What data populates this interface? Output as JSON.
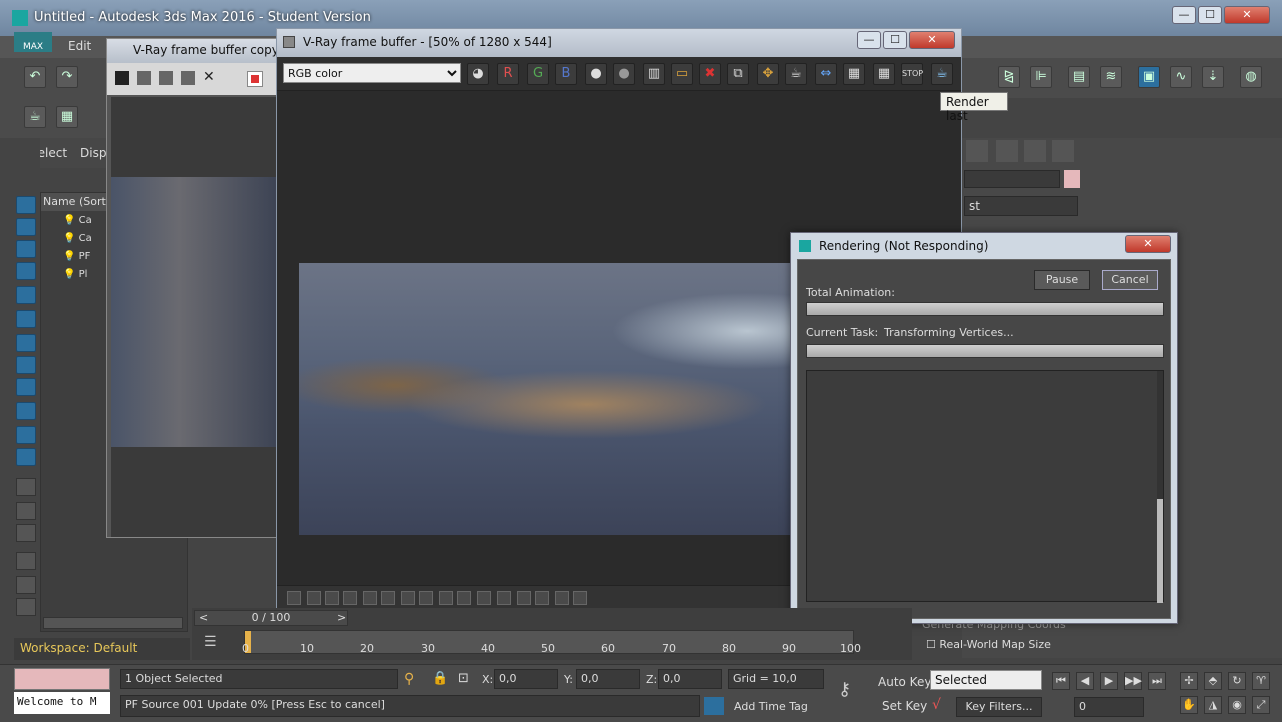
{
  "app": {
    "title": "Untitled - Autodesk 3ds Max 2016 - Student Version",
    "max_button": "MAX",
    "menu": [
      "Edit"
    ],
    "win_controls": {
      "min": "—",
      "max": "☐",
      "close": "✕"
    }
  },
  "command_panel": {
    "select_tab": "Select",
    "display_tab": "Disp",
    "list_value": "st",
    "real_world_map": "Real-World Map Size",
    "generate_mapping": "Generate Mapping Coords"
  },
  "scene_explorer": {
    "header": "Name (Sorte",
    "rows": [
      "Ca",
      "Ca",
      "PF",
      "Pl"
    ]
  },
  "vfb_copy": {
    "title": "V-Ray frame buffer copy, D"
  },
  "vfb": {
    "title": "V-Ray frame buffer - [50% of 1280 x 544]",
    "channel": "RGB color",
    "channel_buttons": {
      "r": "R",
      "g": "G",
      "b": "B"
    },
    "tooltip": "Render last"
  },
  "render_dialog": {
    "title": "Rendering (Not Responding)",
    "pause": "Pause",
    "cancel": "Cancel",
    "total_label": "Total Animation:",
    "task_label": "Current Task:",
    "task_value": "Transforming Vertices..."
  },
  "timeline": {
    "frame_counter": "0 / 100",
    "ticks": [
      "0",
      "10",
      "20",
      "30",
      "40",
      "50",
      "60",
      "70",
      "80",
      "90",
      "100"
    ],
    "prev": "<",
    "next": ">"
  },
  "workspace": "Workspace: Default",
  "status": {
    "selection": "1 Object Selected",
    "prompt": "PF Source 001 Update 0% [Press Esc to cancel]",
    "x_label": "X:",
    "x_value": "0,0",
    "y_label": "Y:",
    "y_value": "0,0",
    "z_label": "Z:",
    "z_value": "0,0",
    "grid": "Grid = 10,0",
    "add_time_tag": "Add Time Tag",
    "auto_key": "Auto Key",
    "set_key": "Set Key",
    "selected": "Selected",
    "key_filters": "Key Filters...",
    "frame": "0",
    "welcome": "Welcome to M"
  },
  "colors": {
    "accent": "#1aa6a0",
    "progress_fill": "#bdbdbd",
    "timeline_marker": "#e6b24a",
    "workspace_text": "#e8c85a"
  }
}
